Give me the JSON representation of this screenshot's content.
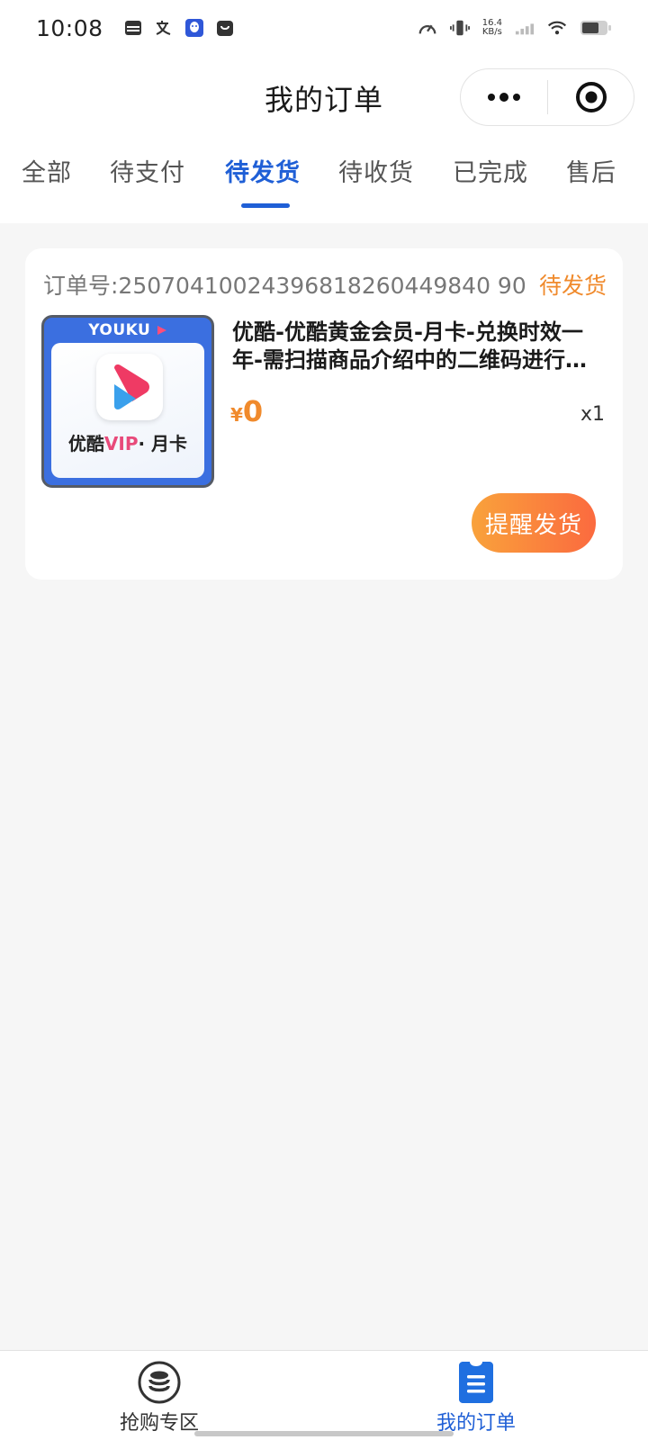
{
  "status_bar": {
    "time": "10:08",
    "net_speed_value": "16.4",
    "net_speed_unit": "KB/s",
    "icons": [
      "card-icon",
      "translate-icon",
      "qq-icon",
      "shopping-bag-icon",
      "speedometer-icon",
      "vibrate-icon",
      "signal-icon",
      "wifi-icon",
      "battery-icon"
    ]
  },
  "header": {
    "title": "我的订单"
  },
  "tabs": [
    {
      "label": "全部"
    },
    {
      "label": "待支付"
    },
    {
      "label": "待发货"
    },
    {
      "label": "待收货"
    },
    {
      "label": "已完成"
    },
    {
      "label": "售后"
    }
  ],
  "active_tab": "待发货",
  "order": {
    "order_no": "订单号:25070410024396818260449840 90",
    "status": "待发货",
    "thumbnail": {
      "brand": "YOUKU",
      "label_prefix": "优酷",
      "label_vip": "VIP",
      "label_suffix": "· 月卡"
    },
    "title": "优酷-优酷黄金会员-月卡-兑换时效一年-需扫描商品介绍中的二维码进行兑换",
    "currency": "¥",
    "price": "0",
    "quantity": "x1",
    "remind_label": "提醒发货"
  },
  "bottom_nav": [
    {
      "label": "抢购专区",
      "icon": "coins-icon"
    },
    {
      "label": "我的订单",
      "icon": "orders-icon"
    }
  ],
  "colors": {
    "accent": "#1f5fd6",
    "status_orange": "#f08a2c",
    "button_gradient_start": "#f9a23b",
    "button_gradient_end": "#fb6a3f",
    "background": "#f6f6f6"
  }
}
